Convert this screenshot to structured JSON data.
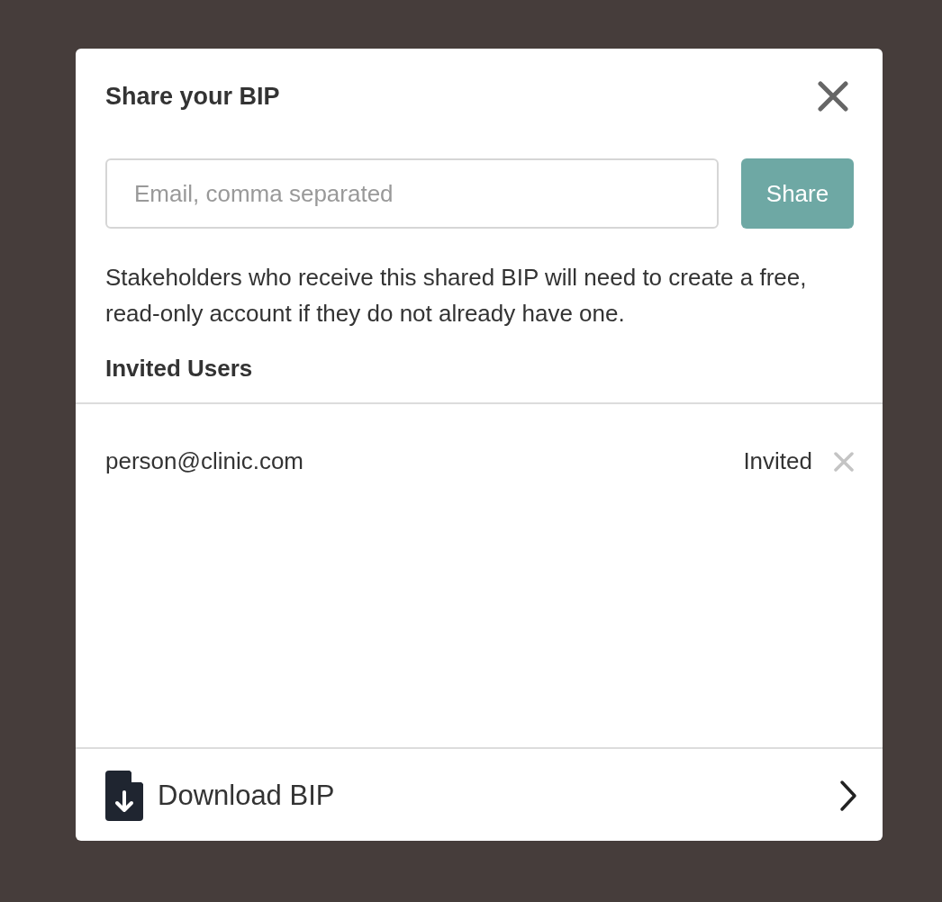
{
  "dialog": {
    "title": "Share your BIP",
    "email_field": {
      "placeholder": "Email, comma separated"
    },
    "share_button": "Share",
    "notice": "Stakeholders who receive this shared BIP will need to create a free, read-only account if they do not already have one.",
    "invited_heading": "Invited Users",
    "invited_users": [
      {
        "email": "person@clinic.com",
        "status": "Invited"
      }
    ],
    "download": "Download BIP"
  }
}
